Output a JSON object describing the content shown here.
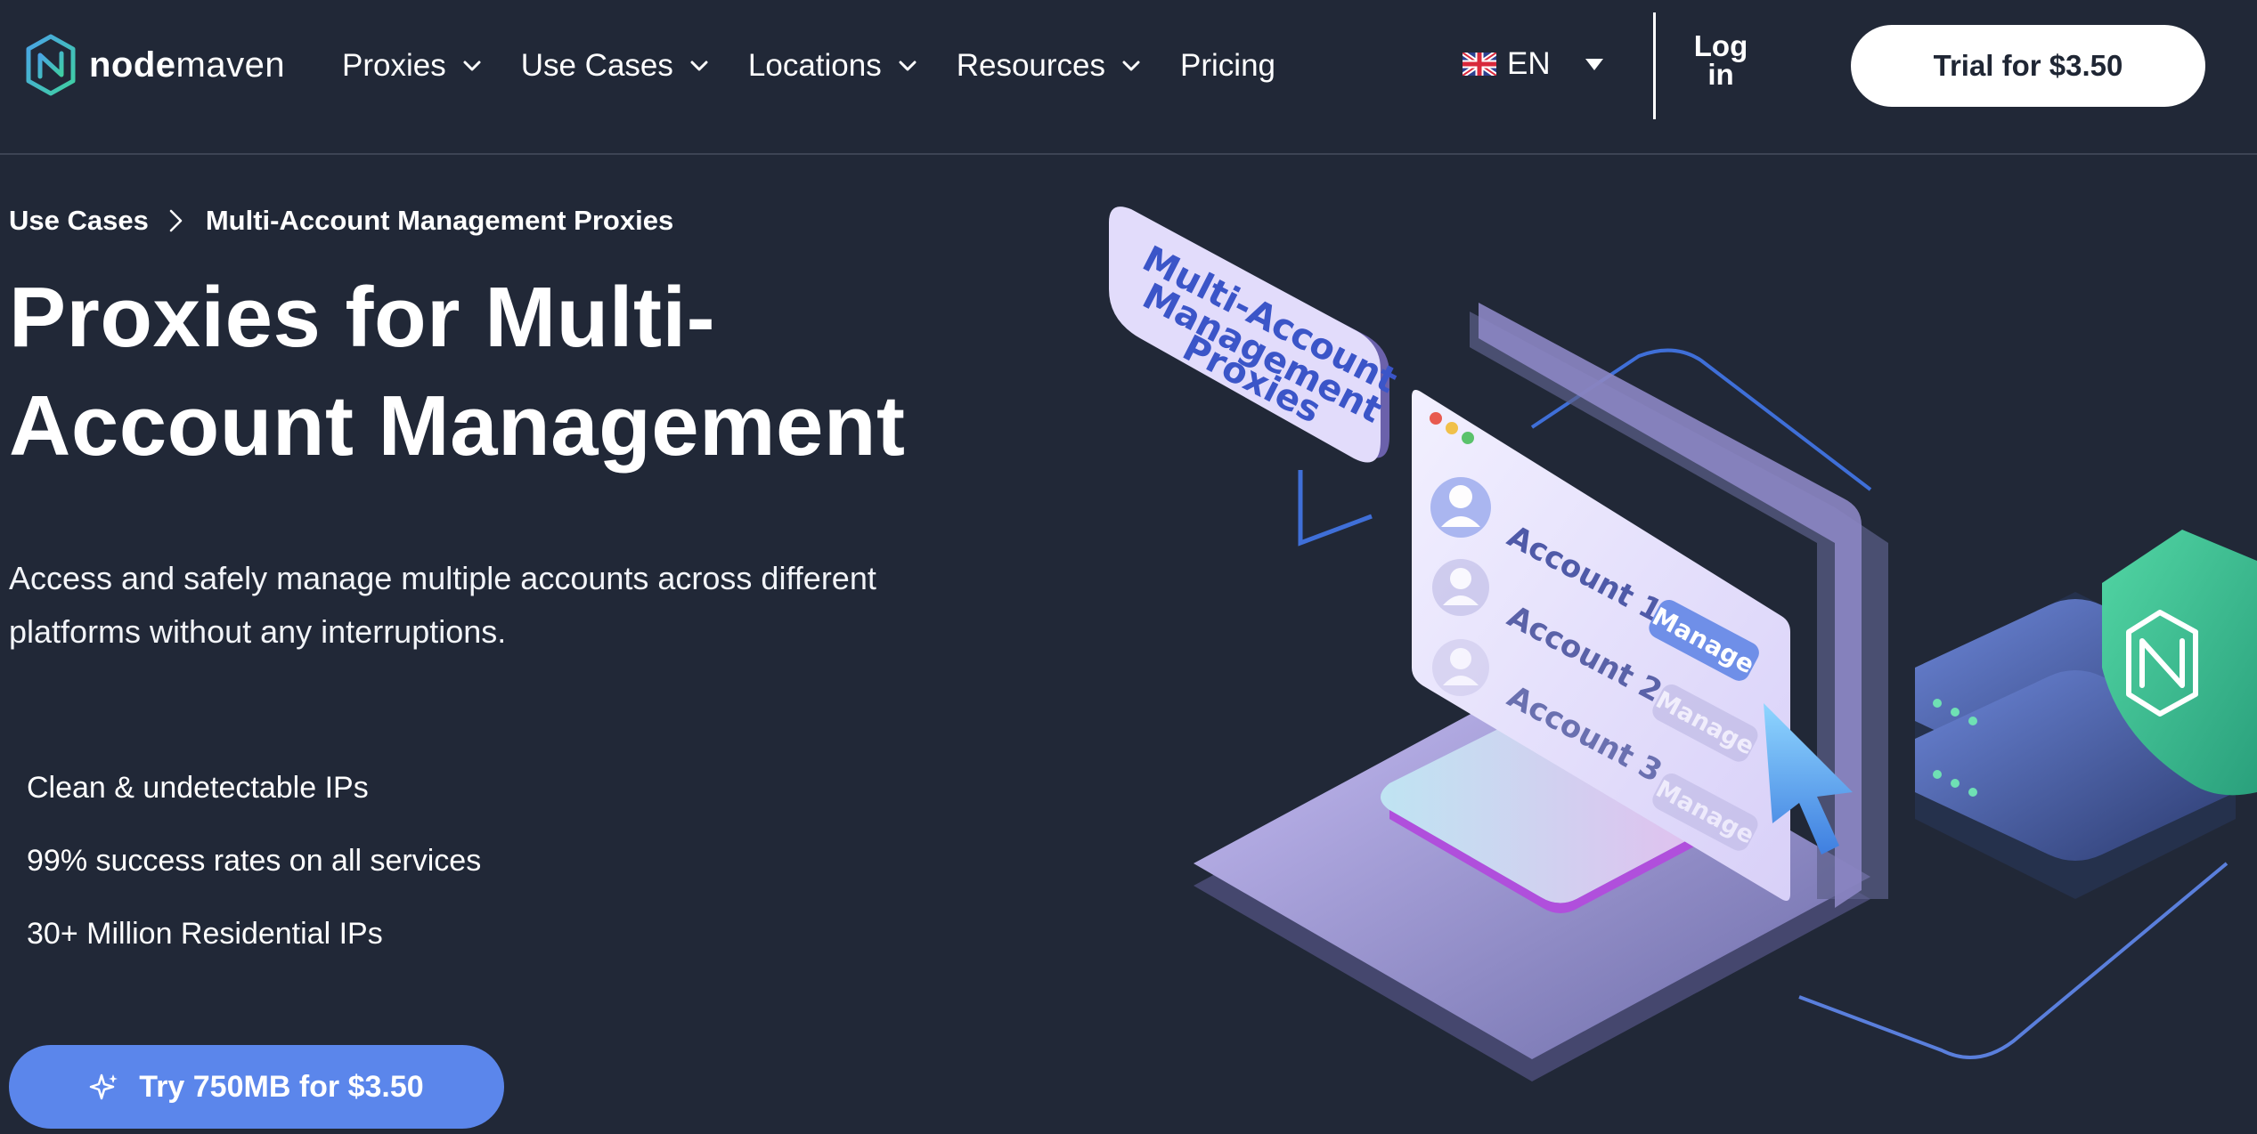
{
  "header": {
    "brand_bold": "node",
    "brand_light": "maven",
    "nav": [
      {
        "label": "Proxies",
        "has_dropdown": true
      },
      {
        "label": "Use Cases",
        "has_dropdown": true
      },
      {
        "label": "Locations",
        "has_dropdown": true
      },
      {
        "label": "Resources",
        "has_dropdown": true
      },
      {
        "label": "Pricing",
        "has_dropdown": false
      }
    ],
    "language": "EN",
    "login_label": "Log in",
    "trial_label": "Trial for $3.50"
  },
  "hero": {
    "breadcrumb": {
      "parent": "Use Cases",
      "current": "Multi-Account Management Proxies"
    },
    "title": "Proxies for Multi-Account Management",
    "subtitle": "Access and safely manage multiple accounts across different platforms without any interruptions.",
    "features": [
      "Clean & undetectable IPs",
      "99% success rates on all services",
      "30+ Million Residential IPs"
    ],
    "cta_label": "Try 750MB for $3.50"
  },
  "illustration": {
    "card_lines": [
      "Multi-Account",
      "Management",
      "Proxies"
    ],
    "accounts": [
      "Account 1",
      "Account 2",
      "Account 3"
    ],
    "manage_label": "Manage"
  },
  "colors": {
    "background": "#212837",
    "cta": "#5b86eb",
    "accent_green": "#3fc59b",
    "accent_purple": "#b7a9ee"
  }
}
